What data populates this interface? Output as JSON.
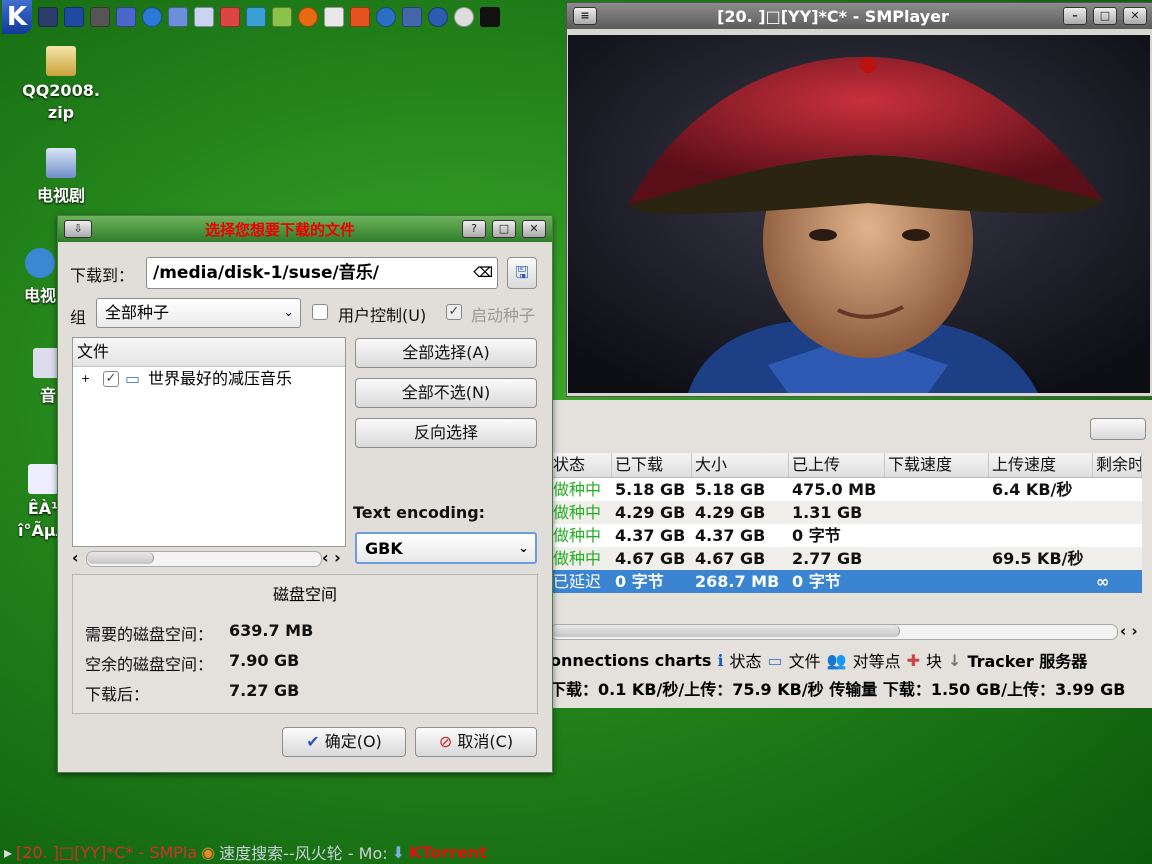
{
  "top_panel": {
    "icons": [
      "kmenu-icon",
      "desktop-icon",
      "terminal-icon",
      "monitor-icon",
      "package-icon",
      "globe-icon",
      "folder-icon",
      "document-icon",
      "chess-icon",
      "kopete-icon",
      "mail-icon",
      "firefox-icon",
      "network-icon",
      "fire-icon",
      "weather-icon",
      "screen-icon",
      "network2-icon",
      "shutdown-icon",
      "eye-icon"
    ],
    "kmenu_label": "K"
  },
  "desktop": {
    "icons": [
      {
        "label": "QQ2008.\nzip"
      },
      {
        "label": "电视剧"
      },
      {
        "label": "电视"
      },
      {
        "label": "音"
      },
      {
        "label": "ÊÀ¹\nî°ÃµÀ"
      }
    ]
  },
  "smplayer": {
    "title": "[20. ]□[YY]*C* - SMPlayer"
  },
  "ktorrent": {
    "columns": [
      "状态",
      "已下载",
      "大小",
      "已上传",
      "下载速度",
      "上传速度",
      "剩余时"
    ],
    "rows": [
      {
        "status": "做种中",
        "downloaded": "5.18 GB",
        "size": "5.18 GB",
        "uploaded": "475.0 MB",
        "down_speed": "",
        "up_speed": "6.4 KB/秒",
        "eta": ""
      },
      {
        "status": "做种中",
        "downloaded": "4.29 GB",
        "size": "4.29 GB",
        "uploaded": "1.31 GB",
        "down_speed": "",
        "up_speed": "",
        "eta": ""
      },
      {
        "status": "做种中",
        "downloaded": "4.37 GB",
        "size": "4.37 GB",
        "uploaded": "0 字节",
        "down_speed": "",
        "up_speed": "",
        "eta": ""
      },
      {
        "status": "做种中",
        "downloaded": "4.67 GB",
        "size": "4.67 GB",
        "uploaded": "2.77 GB",
        "down_speed": "",
        "up_speed": "69.5 KB/秒",
        "eta": ""
      },
      {
        "status": "已延迟",
        "downloaded": "0 字节",
        "size": "268.7 MB",
        "uploaded": "0 字节",
        "down_speed": "",
        "up_speed": "",
        "eta": "∞"
      }
    ],
    "tabs": [
      "onnections charts",
      "状态",
      "文件",
      "对等点",
      "块",
      "Tracker 服务器"
    ],
    "statusbar": "下载：0.1 KB/秒/上传：75.9 KB/秒 传输量 下载：1.50 GB/上传：3.99 GB"
  },
  "dialog": {
    "title": "选择您想要下载的文件",
    "download_to_label": "下载到：",
    "download_path": "/media/disk-1/suse/音乐/",
    "group_label": "组",
    "group_value": "全部种子",
    "user_control_label": "用户控制(U)",
    "start_seed_label": "启动种子",
    "files_header": "文件",
    "file_item": "世界最好的减压音乐",
    "select_all": "全部选择(A)",
    "select_none": "全部不选(N)",
    "invert_selection": "反向选择",
    "text_encoding_label": "Text encoding:",
    "encoding_value": "GBK",
    "disk_space_title": "磁盘空间",
    "required_label": "需要的磁盘空间：",
    "required_value": "639.7 MB",
    "free_label": "空余的磁盘空间：",
    "free_value": "7.90 GB",
    "after_label": "下载后：",
    "after_value": "7.27 GB",
    "ok": "确定(O)",
    "cancel": "取消(C)"
  },
  "taskbar": {
    "items": [
      "[20. ]□[YY]*C* - SMPla",
      "速度搜索--风火轮 - Mo:",
      "KTorrent"
    ]
  },
  "colors": {
    "seeding_green": "#22b022",
    "selected_row": "#3a84d2",
    "dialog_title_text": "#e00000"
  }
}
